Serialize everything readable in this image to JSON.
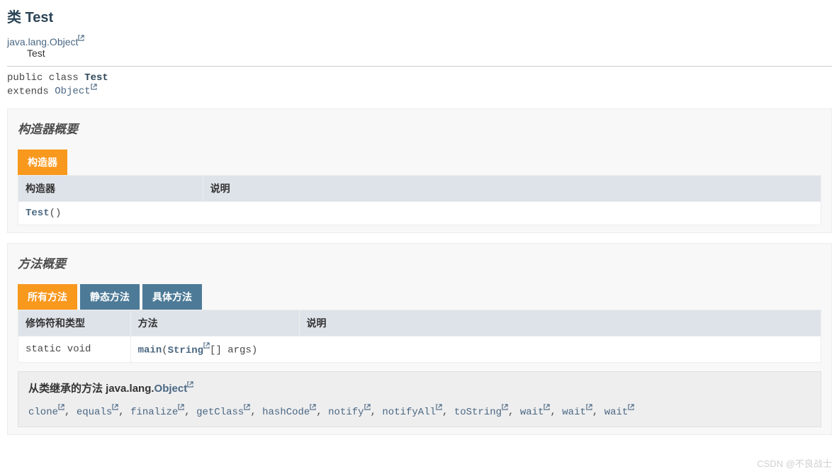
{
  "header": {
    "title": "类 Test",
    "inheritance_parent": "java.lang.Object",
    "inheritance_child": "Test"
  },
  "signature": {
    "modifiers": "public class ",
    "class_name": "Test",
    "extends_kw": "extends ",
    "extends_link": "Object"
  },
  "constructor_section": {
    "title": "构造器概要",
    "tab": "构造器",
    "col_constructor": "构造器",
    "col_desc": "说明",
    "rows": [
      {
        "name": "Test",
        "params": "()"
      }
    ]
  },
  "method_section": {
    "title": "方法概要",
    "tabs": [
      {
        "label": "所有方法",
        "active": true
      },
      {
        "label": "静态方法",
        "active": false
      },
      {
        "label": "具体方法",
        "active": false
      }
    ],
    "col_modifier": "修饰符和类型",
    "col_method": "方法",
    "col_desc": "说明",
    "rows": [
      {
        "modifier": "static void",
        "name": "main",
        "param_type": "String",
        "param_suffix": "[]  args)"
      }
    ]
  },
  "inherited": {
    "prefix": "从类继承的方法 java.lang.",
    "class_link": "Object",
    "methods": [
      "clone",
      "equals",
      "finalize",
      "getClass",
      "hashCode",
      "notify",
      "notifyAll",
      "toString",
      "wait",
      "wait",
      "wait"
    ]
  },
  "watermark": "CSDN @不良战士"
}
